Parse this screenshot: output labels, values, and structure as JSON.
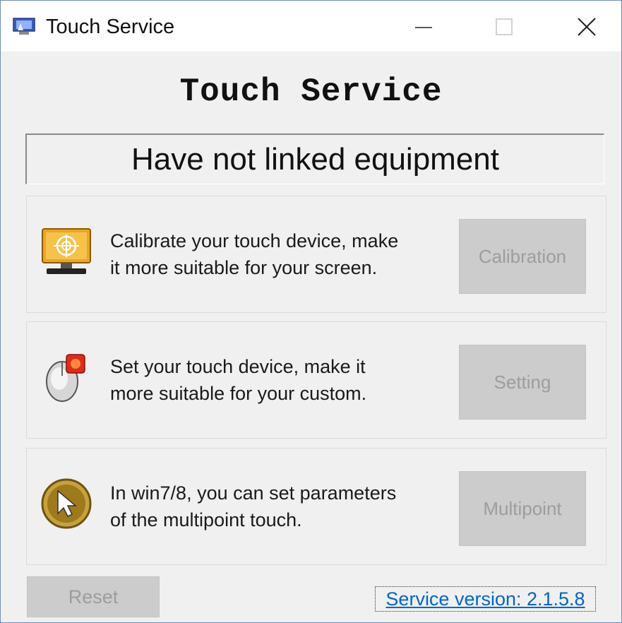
{
  "window": {
    "title": "Touch Service"
  },
  "app_title": "Touch Service",
  "status": "Have not linked equipment",
  "panels": [
    {
      "description_line1": "Calibrate your touch device, make",
      "description_line2": "it more suitable for your screen.",
      "button_label": "Calibration",
      "icon": "calibration-monitor-icon"
    },
    {
      "description_line1": "Set your touch device, make it",
      "description_line2": "more suitable for your custom.",
      "button_label": "Setting",
      "icon": "mouse-setting-icon"
    },
    {
      "description_line1": "In win7/8, you can set parameters",
      "description_line2": "of the multipoint touch.",
      "button_label": "Multipoint",
      "icon": "cursor-circle-icon"
    }
  ],
  "footer": {
    "reset_label": "Reset",
    "version_link": "Service version: 2.1.5.8"
  },
  "colors": {
    "window_bg": "#f0f0f0",
    "disabled_button_bg": "#cccccc",
    "disabled_button_text": "#9d9d9d",
    "link": "#0066cc",
    "icon_gold": "#c8a13a"
  }
}
